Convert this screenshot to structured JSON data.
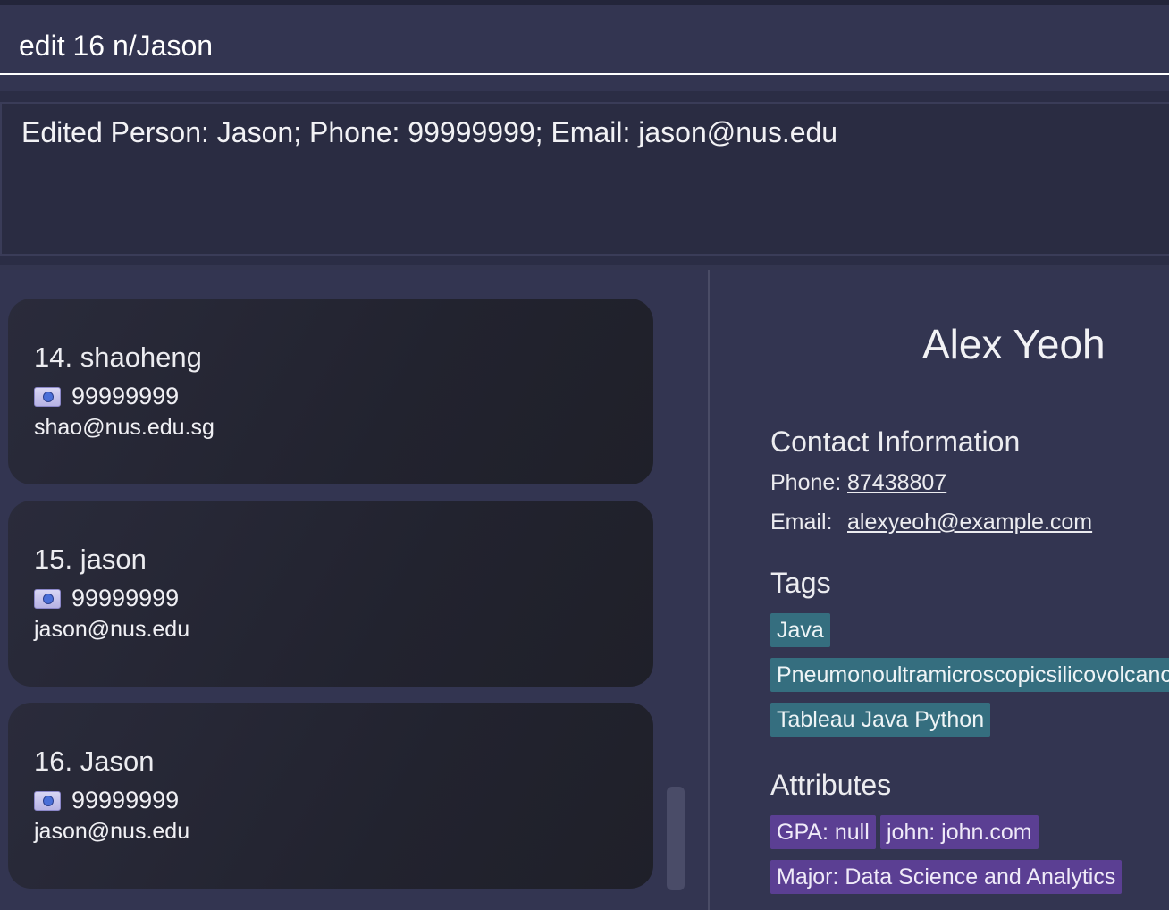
{
  "command": {
    "value": "edit 16 n/Jason"
  },
  "result": {
    "text": "Edited Person: Jason; Phone: 99999999; Email: jason@nus.edu"
  },
  "persons": [
    {
      "title": "14. shaoheng",
      "phone": "99999999",
      "email": "shao@nus.edu.sg"
    },
    {
      "title": "15. jason",
      "phone": "99999999",
      "email": "jason@nus.edu"
    },
    {
      "title": "16. Jason",
      "phone": "99999999",
      "email": "jason@nus.edu"
    }
  ],
  "detail": {
    "name": "Alex Yeoh",
    "contact_heading": "Contact Information",
    "phone_label": "Phone:",
    "phone_value": "87438807",
    "email_label": "Email:",
    "email_value": "alexyeoh@example.com",
    "tags_heading": "Tags",
    "tags": [
      "Java",
      "Pneumonoultramicroscopicsilicovolcanoconiosis",
      "Tableau Java Python"
    ],
    "attributes_heading": "Attributes",
    "attributes": [
      "GPA: null",
      "john: john.com",
      "Major: Data Science and Analytics"
    ]
  },
  "icons": {
    "phone": "phone-card-icon"
  },
  "colors": {
    "tag": "#356e7f",
    "attribute": "#5b3f93",
    "background": "#333551"
  }
}
